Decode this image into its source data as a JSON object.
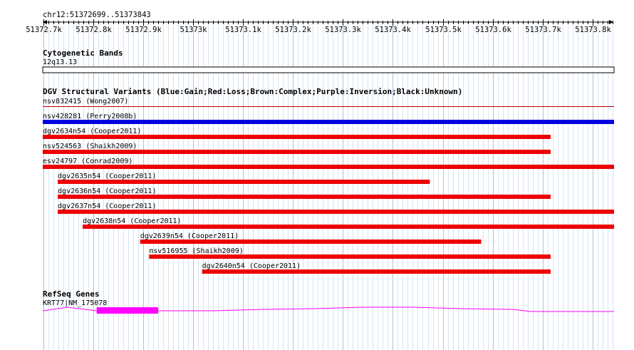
{
  "browser": {
    "region_label": "chr12:51372699..51373843",
    "region_start": 51372699,
    "region_end": 51373843,
    "ruler": {
      "major_ticks": [
        51372700,
        51372800,
        51372900,
        51373000,
        51373100,
        51373200,
        51373300,
        51373400,
        51373500,
        51373600,
        51373700,
        51373800
      ],
      "tick_labels": [
        "51372.7k",
        "51372.8k",
        "51372.9k",
        "51373k",
        "51373.1k",
        "51373.2k",
        "51373.3k",
        "51373.4k",
        "51373.5k",
        "51373.6k",
        "51373.7k",
        "51373.8k"
      ],
      "minor_step": 10
    }
  },
  "tracks": {
    "cytoband": {
      "title": "Cytogenetic Bands",
      "band_label": "12q13.13"
    },
    "dgv": {
      "title": "DGV Structural Variants (Blue:Gain;Red:Loss;Brown:Complex;Purple:Inversion;Black:Unknown)",
      "colors": {
        "gain": "#0000e0",
        "loss": "#ee0000",
        "thin_loss": "#cc0000"
      },
      "features": [
        {
          "label": "nsv832415 (Wong2007)",
          "start": 51372699,
          "end": 51373843,
          "type": "loss",
          "style": "thin"
        },
        {
          "label": "nsv428281 (Perry2008b)",
          "start": 51372699,
          "end": 51373843,
          "type": "gain",
          "style": "thick"
        },
        {
          "label": "dgv2634n54 (Cooper2011)",
          "start": 51372699,
          "end": 51373716,
          "type": "loss",
          "style": "thick"
        },
        {
          "label": "nsv524563 (Shaikh2009)",
          "start": 51372699,
          "end": 51373716,
          "type": "loss",
          "style": "thick"
        },
        {
          "label": "esv24797 (Conrad2009)",
          "start": 51372699,
          "end": 51373843,
          "type": "loss",
          "style": "thick"
        },
        {
          "label": "dgv2635n54 (Cooper2011)",
          "start": 51372729,
          "end": 51373474,
          "type": "loss",
          "style": "thick"
        },
        {
          "label": "dgv2636n54 (Cooper2011)",
          "start": 51372729,
          "end": 51373716,
          "type": "loss",
          "style": "thick"
        },
        {
          "label": "dgv2637n54 (Cooper2011)",
          "start": 51372729,
          "end": 51373843,
          "type": "loss",
          "style": "thick"
        },
        {
          "label": "dgv2638n54 (Cooper2011)",
          "start": 51372779,
          "end": 51373843,
          "type": "loss",
          "style": "thick"
        },
        {
          "label": "dgv2639n54 (Cooper2011)",
          "start": 51372894,
          "end": 51373577,
          "type": "loss",
          "style": "thick"
        },
        {
          "label": "nsv516955 (Shaikh2009)",
          "start": 51372912,
          "end": 51373716,
          "type": "loss",
          "style": "thick"
        },
        {
          "label": "dgv2640n54 (Cooper2011)",
          "start": 51373018,
          "end": 51373716,
          "type": "loss",
          "style": "thick"
        }
      ]
    },
    "refseq": {
      "title": "RefSeq Genes",
      "gene_label": "KRT77|NM_175078",
      "color": "#ff00ff",
      "exon_start": 51372807,
      "exon_end": 51372930
    }
  }
}
